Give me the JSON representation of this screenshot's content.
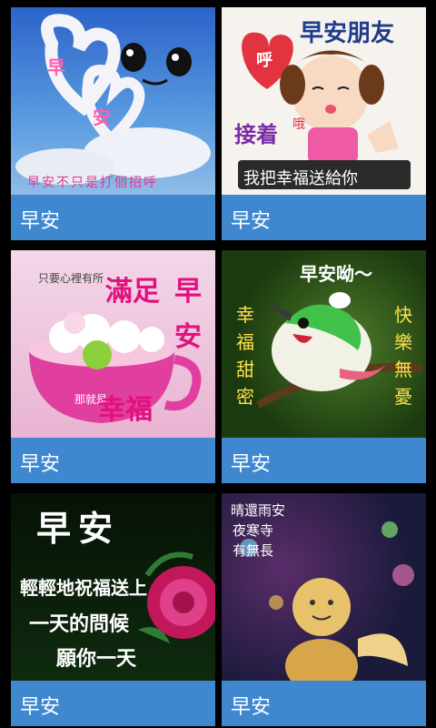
{
  "cards": [
    {
      "caption": "早安",
      "image_text": {
        "heart": "早",
        "heart2": "安",
        "bottom": "早安不只是打個招呼"
      }
    },
    {
      "caption": "早安",
      "image_text": {
        "title": "早安朋友",
        "badge": "呼",
        "left": "接着",
        "oh": "哦",
        "bottom": "我把幸福送給你"
      }
    },
    {
      "caption": "早安",
      "image_text": {
        "small": "只要心裡有所",
        "main": "滿足",
        "side1": "早",
        "side2": "安",
        "small2": "那就是",
        "bottom": "幸福"
      }
    },
    {
      "caption": "早安",
      "image_text": {
        "title": "早安呦～",
        "left": [
          "幸",
          "福",
          "甜",
          "密"
        ],
        "right": [
          "快",
          "樂",
          "無",
          "憂"
        ]
      }
    },
    {
      "caption": "早安",
      "image_text": {
        "title": "早安",
        "line1": "輕輕地祝福送上",
        "line2": "一天的問候",
        "line3": "願你一天"
      }
    },
    {
      "caption": "早安",
      "image_text": {
        "line1": "晴還雨安",
        "line2": "夜寒寺",
        "line3": "有無長"
      }
    }
  ]
}
